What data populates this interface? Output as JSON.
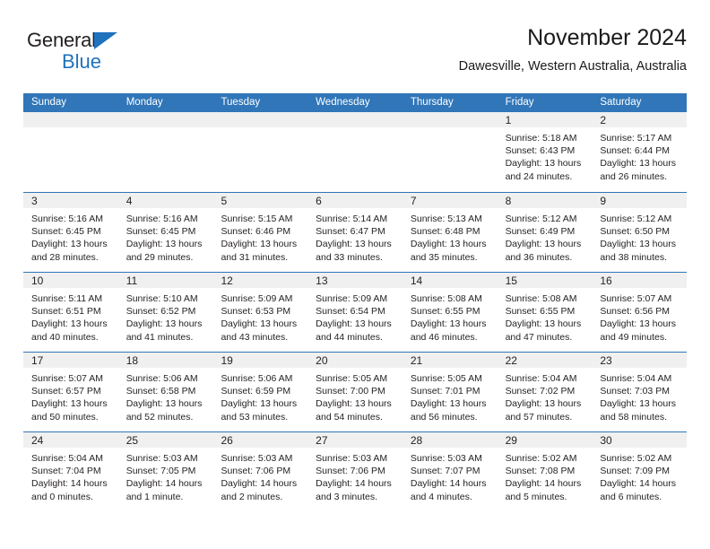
{
  "brand": {
    "name_part1": "General",
    "name_part2": "Blue",
    "accent_color": "#1f72bd"
  },
  "header": {
    "title": "November 2024",
    "location": "Dawesville, Western Australia, Australia"
  },
  "theme": {
    "header_bar_color": "#3076b8",
    "day_number_strip_color": "#f0f0f0",
    "text_color": "#231f20"
  },
  "weekdays": [
    "Sunday",
    "Monday",
    "Tuesday",
    "Wednesday",
    "Thursday",
    "Friday",
    "Saturday"
  ],
  "weeks": [
    [
      {
        "day": "",
        "sunrise": "",
        "sunset": "",
        "daylight1": "",
        "daylight2": ""
      },
      {
        "day": "",
        "sunrise": "",
        "sunset": "",
        "daylight1": "",
        "daylight2": ""
      },
      {
        "day": "",
        "sunrise": "",
        "sunset": "",
        "daylight1": "",
        "daylight2": ""
      },
      {
        "day": "",
        "sunrise": "",
        "sunset": "",
        "daylight1": "",
        "daylight2": ""
      },
      {
        "day": "",
        "sunrise": "",
        "sunset": "",
        "daylight1": "",
        "daylight2": ""
      },
      {
        "day": "1",
        "sunrise": "Sunrise: 5:18 AM",
        "sunset": "Sunset: 6:43 PM",
        "daylight1": "Daylight: 13 hours",
        "daylight2": "and 24 minutes."
      },
      {
        "day": "2",
        "sunrise": "Sunrise: 5:17 AM",
        "sunset": "Sunset: 6:44 PM",
        "daylight1": "Daylight: 13 hours",
        "daylight2": "and 26 minutes."
      }
    ],
    [
      {
        "day": "3",
        "sunrise": "Sunrise: 5:16 AM",
        "sunset": "Sunset: 6:45 PM",
        "daylight1": "Daylight: 13 hours",
        "daylight2": "and 28 minutes."
      },
      {
        "day": "4",
        "sunrise": "Sunrise: 5:16 AM",
        "sunset": "Sunset: 6:45 PM",
        "daylight1": "Daylight: 13 hours",
        "daylight2": "and 29 minutes."
      },
      {
        "day": "5",
        "sunrise": "Sunrise: 5:15 AM",
        "sunset": "Sunset: 6:46 PM",
        "daylight1": "Daylight: 13 hours",
        "daylight2": "and 31 minutes."
      },
      {
        "day": "6",
        "sunrise": "Sunrise: 5:14 AM",
        "sunset": "Sunset: 6:47 PM",
        "daylight1": "Daylight: 13 hours",
        "daylight2": "and 33 minutes."
      },
      {
        "day": "7",
        "sunrise": "Sunrise: 5:13 AM",
        "sunset": "Sunset: 6:48 PM",
        "daylight1": "Daylight: 13 hours",
        "daylight2": "and 35 minutes."
      },
      {
        "day": "8",
        "sunrise": "Sunrise: 5:12 AM",
        "sunset": "Sunset: 6:49 PM",
        "daylight1": "Daylight: 13 hours",
        "daylight2": "and 36 minutes."
      },
      {
        "day": "9",
        "sunrise": "Sunrise: 5:12 AM",
        "sunset": "Sunset: 6:50 PM",
        "daylight1": "Daylight: 13 hours",
        "daylight2": "and 38 minutes."
      }
    ],
    [
      {
        "day": "10",
        "sunrise": "Sunrise: 5:11 AM",
        "sunset": "Sunset: 6:51 PM",
        "daylight1": "Daylight: 13 hours",
        "daylight2": "and 40 minutes."
      },
      {
        "day": "11",
        "sunrise": "Sunrise: 5:10 AM",
        "sunset": "Sunset: 6:52 PM",
        "daylight1": "Daylight: 13 hours",
        "daylight2": "and 41 minutes."
      },
      {
        "day": "12",
        "sunrise": "Sunrise: 5:09 AM",
        "sunset": "Sunset: 6:53 PM",
        "daylight1": "Daylight: 13 hours",
        "daylight2": "and 43 minutes."
      },
      {
        "day": "13",
        "sunrise": "Sunrise: 5:09 AM",
        "sunset": "Sunset: 6:54 PM",
        "daylight1": "Daylight: 13 hours",
        "daylight2": "and 44 minutes."
      },
      {
        "day": "14",
        "sunrise": "Sunrise: 5:08 AM",
        "sunset": "Sunset: 6:55 PM",
        "daylight1": "Daylight: 13 hours",
        "daylight2": "and 46 minutes."
      },
      {
        "day": "15",
        "sunrise": "Sunrise: 5:08 AM",
        "sunset": "Sunset: 6:55 PM",
        "daylight1": "Daylight: 13 hours",
        "daylight2": "and 47 minutes."
      },
      {
        "day": "16",
        "sunrise": "Sunrise: 5:07 AM",
        "sunset": "Sunset: 6:56 PM",
        "daylight1": "Daylight: 13 hours",
        "daylight2": "and 49 minutes."
      }
    ],
    [
      {
        "day": "17",
        "sunrise": "Sunrise: 5:07 AM",
        "sunset": "Sunset: 6:57 PM",
        "daylight1": "Daylight: 13 hours",
        "daylight2": "and 50 minutes."
      },
      {
        "day": "18",
        "sunrise": "Sunrise: 5:06 AM",
        "sunset": "Sunset: 6:58 PM",
        "daylight1": "Daylight: 13 hours",
        "daylight2": "and 52 minutes."
      },
      {
        "day": "19",
        "sunrise": "Sunrise: 5:06 AM",
        "sunset": "Sunset: 6:59 PM",
        "daylight1": "Daylight: 13 hours",
        "daylight2": "and 53 minutes."
      },
      {
        "day": "20",
        "sunrise": "Sunrise: 5:05 AM",
        "sunset": "Sunset: 7:00 PM",
        "daylight1": "Daylight: 13 hours",
        "daylight2": "and 54 minutes."
      },
      {
        "day": "21",
        "sunrise": "Sunrise: 5:05 AM",
        "sunset": "Sunset: 7:01 PM",
        "daylight1": "Daylight: 13 hours",
        "daylight2": "and 56 minutes."
      },
      {
        "day": "22",
        "sunrise": "Sunrise: 5:04 AM",
        "sunset": "Sunset: 7:02 PM",
        "daylight1": "Daylight: 13 hours",
        "daylight2": "and 57 minutes."
      },
      {
        "day": "23",
        "sunrise": "Sunrise: 5:04 AM",
        "sunset": "Sunset: 7:03 PM",
        "daylight1": "Daylight: 13 hours",
        "daylight2": "and 58 minutes."
      }
    ],
    [
      {
        "day": "24",
        "sunrise": "Sunrise: 5:04 AM",
        "sunset": "Sunset: 7:04 PM",
        "daylight1": "Daylight: 14 hours",
        "daylight2": "and 0 minutes."
      },
      {
        "day": "25",
        "sunrise": "Sunrise: 5:03 AM",
        "sunset": "Sunset: 7:05 PM",
        "daylight1": "Daylight: 14 hours",
        "daylight2": "and 1 minute."
      },
      {
        "day": "26",
        "sunrise": "Sunrise: 5:03 AM",
        "sunset": "Sunset: 7:06 PM",
        "daylight1": "Daylight: 14 hours",
        "daylight2": "and 2 minutes."
      },
      {
        "day": "27",
        "sunrise": "Sunrise: 5:03 AM",
        "sunset": "Sunset: 7:06 PM",
        "daylight1": "Daylight: 14 hours",
        "daylight2": "and 3 minutes."
      },
      {
        "day": "28",
        "sunrise": "Sunrise: 5:03 AM",
        "sunset": "Sunset: 7:07 PM",
        "daylight1": "Daylight: 14 hours",
        "daylight2": "and 4 minutes."
      },
      {
        "day": "29",
        "sunrise": "Sunrise: 5:02 AM",
        "sunset": "Sunset: 7:08 PM",
        "daylight1": "Daylight: 14 hours",
        "daylight2": "and 5 minutes."
      },
      {
        "day": "30",
        "sunrise": "Sunrise: 5:02 AM",
        "sunset": "Sunset: 7:09 PM",
        "daylight1": "Daylight: 14 hours",
        "daylight2": "and 6 minutes."
      }
    ]
  ]
}
